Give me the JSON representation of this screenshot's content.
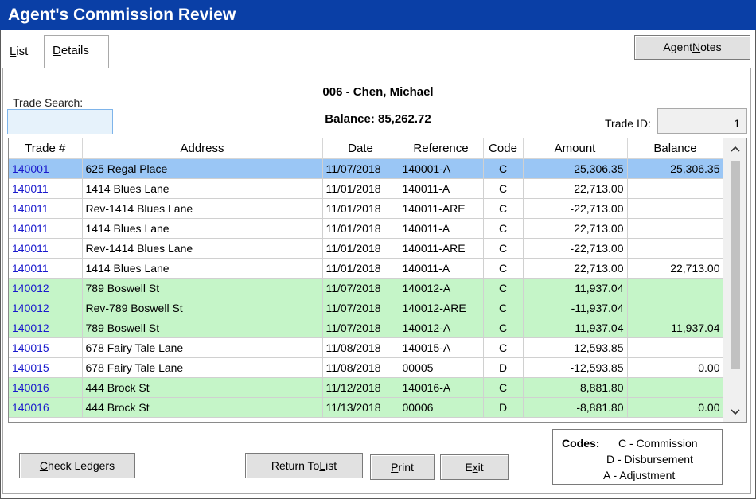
{
  "window": {
    "title": "Agent's Commission Review"
  },
  "tabs": {
    "list_pre": "",
    "list_key": "L",
    "list_post": "ist",
    "details_key": "D",
    "details_post": "etails"
  },
  "agent_notes": {
    "pre": "Agent ",
    "key": "N",
    "post": "otes"
  },
  "trade_search": {
    "label": "Trade Search:",
    "value": ""
  },
  "agent": {
    "name": "006 - Chen, Michael",
    "balance": "Balance: 85,262.72"
  },
  "trade_id": {
    "label": "Trade ID:",
    "value": "1"
  },
  "table": {
    "columns": [
      "Trade #",
      "Address",
      "Date",
      "Reference",
      "Code",
      "Amount",
      "Balance"
    ],
    "rows": [
      {
        "trade": "140001",
        "address": "625 Regal Place",
        "date": "11/07/2018",
        "reference": "140001-A",
        "code": "C",
        "amount": "25,306.35",
        "balance": "25,306.35",
        "style": "sel"
      },
      {
        "trade": "140011",
        "address": "1414 Blues Lane",
        "date": "11/01/2018",
        "reference": "140011-A",
        "code": "C",
        "amount": "22,713.00",
        "balance": "",
        "style": "white"
      },
      {
        "trade": "140011",
        "address": "Rev-1414 Blues Lane",
        "date": "11/01/2018",
        "reference": "140011-ARE",
        "code": "C",
        "amount": "-22,713.00",
        "balance": "",
        "style": "white"
      },
      {
        "trade": "140011",
        "address": "1414 Blues Lane",
        "date": "11/01/2018",
        "reference": "140011-A",
        "code": "C",
        "amount": "22,713.00",
        "balance": "",
        "style": "white"
      },
      {
        "trade": "140011",
        "address": "Rev-1414 Blues Lane",
        "date": "11/01/2018",
        "reference": "140011-ARE",
        "code": "C",
        "amount": "-22,713.00",
        "balance": "",
        "style": "white"
      },
      {
        "trade": "140011",
        "address": "1414 Blues Lane",
        "date": "11/01/2018",
        "reference": "140011-A",
        "code": "C",
        "amount": "22,713.00",
        "balance": "22,713.00",
        "style": "white"
      },
      {
        "trade": "140012",
        "address": "789 Boswell St",
        "date": "11/07/2018",
        "reference": "140012-A",
        "code": "C",
        "amount": "11,937.04",
        "balance": "",
        "style": "green"
      },
      {
        "trade": "140012",
        "address": "Rev-789 Boswell St",
        "date": "11/07/2018",
        "reference": "140012-ARE",
        "code": "C",
        "amount": "-11,937.04",
        "balance": "",
        "style": "green"
      },
      {
        "trade": "140012",
        "address": "789 Boswell St",
        "date": "11/07/2018",
        "reference": "140012-A",
        "code": "C",
        "amount": "11,937.04",
        "balance": "11,937.04",
        "style": "green"
      },
      {
        "trade": "140015",
        "address": "678 Fairy Tale Lane",
        "date": "11/08/2018",
        "reference": "140015-A",
        "code": "C",
        "amount": "12,593.85",
        "balance": "",
        "style": "white"
      },
      {
        "trade": "140015",
        "address": "678 Fairy Tale Lane",
        "date": "11/08/2018",
        "reference": "00005",
        "code": "D",
        "amount": "-12,593.85",
        "balance": "0.00",
        "style": "white"
      },
      {
        "trade": "140016",
        "address": "444 Brock St",
        "date": "11/12/2018",
        "reference": "140016-A",
        "code": "C",
        "amount": "8,881.80",
        "balance": "",
        "style": "green"
      },
      {
        "trade": "140016",
        "address": "444 Brock St",
        "date": "11/13/2018",
        "reference": "00006",
        "code": "D",
        "amount": "-8,881.80",
        "balance": "0.00",
        "style": "green"
      }
    ]
  },
  "scrollbar": {
    "up_glyph": "^",
    "down_glyph": "v"
  },
  "buttons": {
    "check_ledgers": {
      "key": "C",
      "post": "heck Ledgers"
    },
    "return_to_list": {
      "pre": "Return To ",
      "key": "L",
      "post": "ist"
    },
    "print": {
      "key": "P",
      "post": "rint"
    },
    "exit": {
      "pre": "E",
      "key": "x",
      "post": "it"
    }
  },
  "codes": {
    "heading": "Codes:",
    "commission": "C - Commission",
    "disbursement": "D - Disbursement",
    "adjustment": "A - Adjustment"
  }
}
